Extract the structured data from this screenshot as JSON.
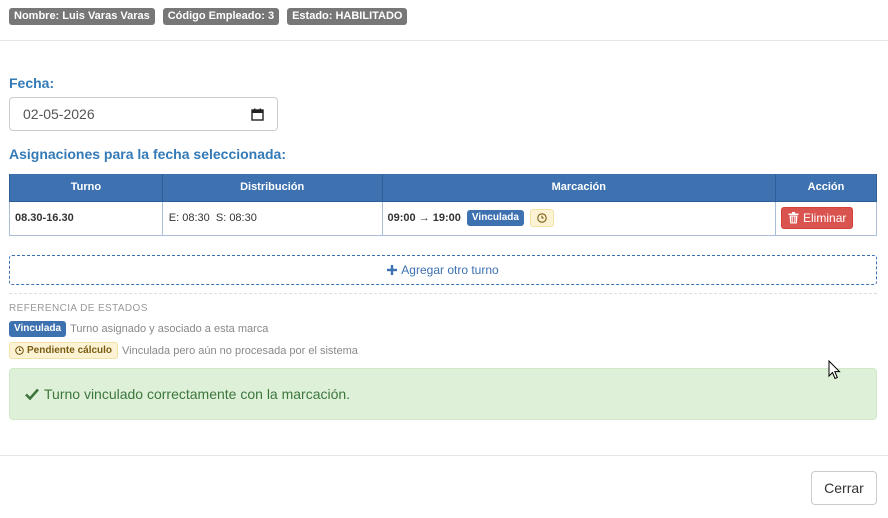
{
  "employee": {
    "name_badge": "Nombre: Luis Varas Varas",
    "code_badge": "Código Empleado: 3",
    "state_badge": "Estado: HABILITADO"
  },
  "fecha": {
    "label": "Fecha:",
    "value": "02-05-2026"
  },
  "asignaciones": {
    "title": "Asignaciones para la fecha seleccionada:",
    "columns": [
      "Turno",
      "Distribución",
      "Marcación",
      "Acción"
    ],
    "rows": [
      {
        "turno": "08.30-16.30",
        "distribucion": "E: 08:30  S: 08:30",
        "marcacion": "09:00 → 19:00",
        "estado": "Vinculada",
        "accion": "Eliminar"
      }
    ],
    "add_label": "Agregar otro turno"
  },
  "referencia": {
    "title": "REFERENCIA DE ESTADOS",
    "items": [
      {
        "badge": "Vinculada",
        "desc": "Turno asignado y asociado a esta marca"
      },
      {
        "badge": "Pendiente cálculo",
        "desc": "Vinculada pero aún no procesada por el sistema"
      }
    ]
  },
  "alert": {
    "message": "Turno vinculado correctamente con la marcación."
  },
  "footer": {
    "close_label": "Cerrar"
  },
  "colors": {
    "primary": "#3d71b0",
    "danger": "#d9534f",
    "success_bg": "#dff0d8",
    "success_text": "#3c763d",
    "warning_bg": "#fcf3d4"
  }
}
